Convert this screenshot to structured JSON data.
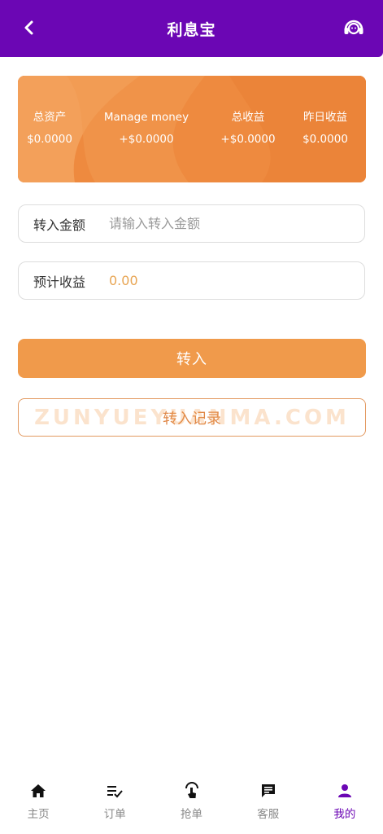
{
  "header": {
    "title": "利息宝",
    "back_icon": "chevron-left-icon",
    "service_icon": "customer-service-icon"
  },
  "summary": {
    "items": [
      {
        "label": "总资产",
        "value": "$0.0000"
      },
      {
        "label": "Manage money",
        "value": "+$0.0000"
      },
      {
        "label": "总收益",
        "value": "+$0.0000"
      },
      {
        "label": "昨日收益",
        "value": "$0.0000"
      }
    ]
  },
  "form": {
    "amount_label": "转入金额",
    "amount_placeholder": "请输入转入金额",
    "amount_value": "",
    "estimate_label": "预计收益",
    "estimate_value": "0.00"
  },
  "actions": {
    "transfer_label": "转入",
    "records_label": "转入记录"
  },
  "watermark": "ZUNYUEYUANMA.COM",
  "tabbar": {
    "items": [
      {
        "label": "主页",
        "icon": "home-icon",
        "active": false
      },
      {
        "label": "订单",
        "icon": "order-list-icon",
        "active": false
      },
      {
        "label": "抢单",
        "icon": "grab-order-icon",
        "active": false
      },
      {
        "label": "客服",
        "icon": "chat-icon",
        "active": false
      },
      {
        "label": "我的",
        "icon": "user-icon",
        "active": true
      }
    ]
  },
  "colors": {
    "brand_purple": "#6b06b4",
    "card_orange": "#ee8a3f",
    "button_orange": "#f09a4b",
    "estimate_text": "#e8a553"
  }
}
